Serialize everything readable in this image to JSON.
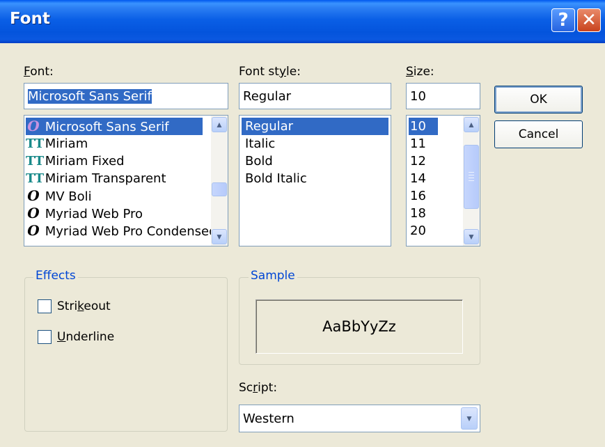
{
  "window": {
    "title": "Font",
    "help_label": "?",
    "close_label": "✕"
  },
  "font": {
    "label_accel": "F",
    "label_rest": "ont:",
    "value": "Microsoft Sans Serif",
    "items": [
      {
        "icon": "O",
        "name": "Microsoft Sans Serif"
      },
      {
        "icon": "TT",
        "name": "Miriam"
      },
      {
        "icon": "TT",
        "name": "Miriam Fixed"
      },
      {
        "icon": "TT",
        "name": "Miriam Transparent"
      },
      {
        "icon": "O",
        "name": "MV Boli"
      },
      {
        "icon": "O",
        "name": "Myriad Web Pro"
      },
      {
        "icon": "O",
        "name": "Myriad Web Pro Condensed"
      }
    ]
  },
  "style": {
    "label_pre": "Font st",
    "label_accel": "y",
    "label_post": "le:",
    "value": "Regular",
    "items": [
      "Regular",
      "Italic",
      "Bold",
      "Bold Italic"
    ]
  },
  "size": {
    "label_accel": "S",
    "label_rest": "ize:",
    "value": "10",
    "items": [
      "10",
      "11",
      "12",
      "14",
      "16",
      "18",
      "20"
    ]
  },
  "buttons": {
    "ok": "OK",
    "cancel": "Cancel"
  },
  "effects": {
    "legend": "Effects",
    "strikeout_pre": "Stri",
    "strikeout_accel": "k",
    "strikeout_post": "eout",
    "underline_accel": "U",
    "underline_rest": "nderline"
  },
  "sample": {
    "legend": "Sample",
    "text": "AaBbYyZz"
  },
  "script": {
    "label_pre": "Sc",
    "label_accel": "r",
    "label_post": "ipt:",
    "value": "Western"
  },
  "icons": {
    "arrow_up": "▲",
    "arrow_down": "▼"
  },
  "colors": {
    "selection": "#316ac5",
    "titlebar": "#0454dc",
    "groupbox_title": "#0046d5"
  }
}
